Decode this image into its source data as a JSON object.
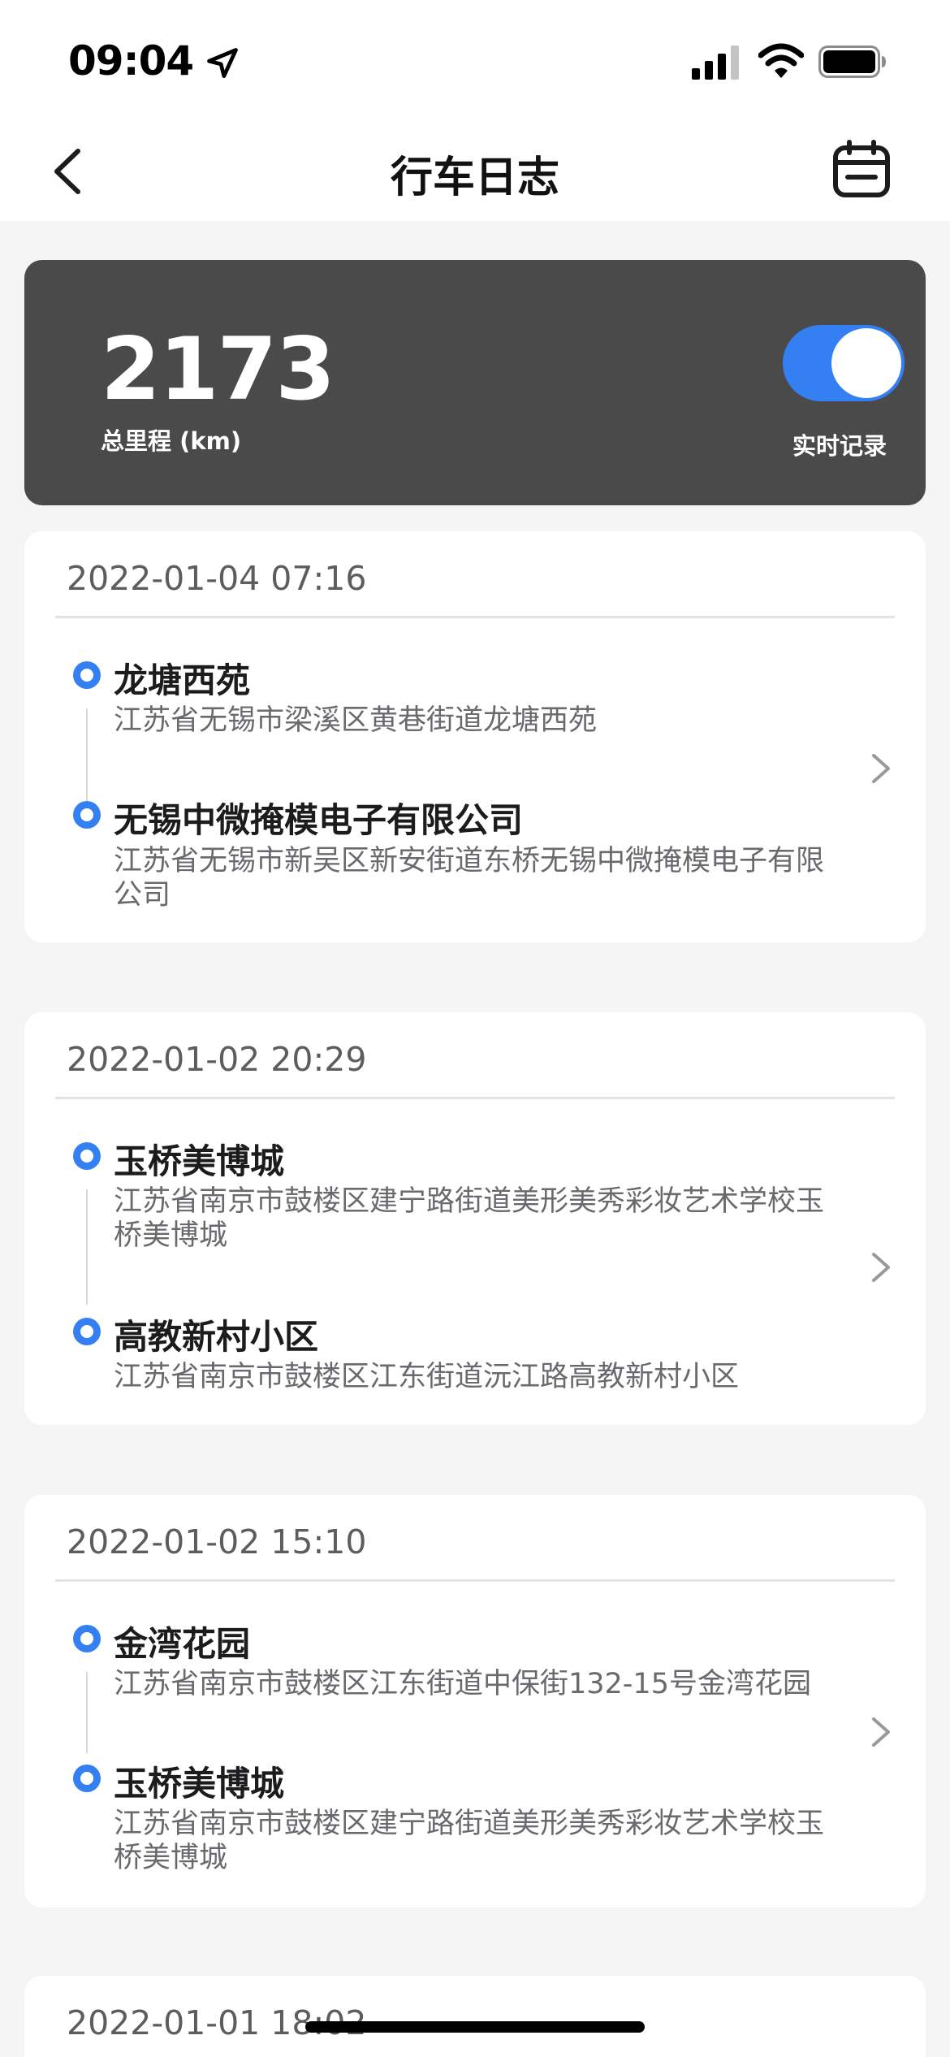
{
  "status_bar": {
    "time": "09:04"
  },
  "nav": {
    "title": "行车日志"
  },
  "summary": {
    "total_mileage": "2173",
    "mileage_label": "总里程 (km)",
    "realtime_label": "实时记录",
    "realtime_on": true,
    "accent_color": "#3480f3"
  },
  "trips": [
    {
      "date": "2022-01-04 07:16",
      "start": {
        "name": "龙塘西苑",
        "address": "江苏省无锡市梁溪区黄巷街道龙塘西苑"
      },
      "end": {
        "name": "无锡中微掩模电子有限公司",
        "address": "江苏省无锡市新吴区新安街道东桥无锡中微掩模电子有限公司"
      }
    },
    {
      "date": "2022-01-02 20:29",
      "start": {
        "name": "玉桥美博城",
        "address": "江苏省南京市鼓楼区建宁路街道美形美秀彩妆艺术学校玉桥美博城"
      },
      "end": {
        "name": "高教新村小区",
        "address": "江苏省南京市鼓楼区江东街道沅江路高教新村小区"
      }
    },
    {
      "date": "2022-01-02 15:10",
      "start": {
        "name": "金湾花园",
        "address": "江苏省南京市鼓楼区江东街道中保街132-15号金湾花园"
      },
      "end": {
        "name": "玉桥美博城",
        "address": "江苏省南京市鼓楼区建宁路街道美形美秀彩妆艺术学校玉桥美博城"
      }
    },
    {
      "date": "2022-01-01 18:02"
    }
  ]
}
